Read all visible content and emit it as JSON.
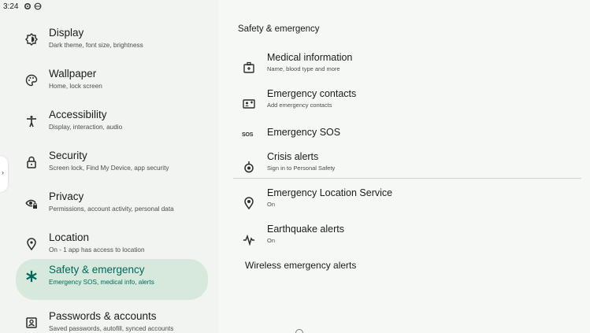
{
  "status_bar": {
    "time": "3:24",
    "icons": [
      "gear-icon",
      "vpn-icon",
      "wifi-icon"
    ]
  },
  "edge_handle": {
    "glyph": "›"
  },
  "sidebar": {
    "items": [
      {
        "title": "Display",
        "subtitle": "Dark theme, font size, brightness",
        "icon": "display-icon"
      },
      {
        "title": "Wallpaper",
        "subtitle": "Home, lock screen",
        "icon": "palette-icon"
      },
      {
        "title": "Accessibility",
        "subtitle": "Display, interaction, audio",
        "icon": "accessibility-icon"
      },
      {
        "title": "Security",
        "subtitle": "Screen lock, Find My Device, app security",
        "icon": "lock-icon"
      },
      {
        "title": "Privacy",
        "subtitle": "Permissions, account activity, personal data",
        "icon": "eye-lock-icon"
      },
      {
        "title": "Location",
        "subtitle": "On - 1 app has access to location",
        "icon": "location-pin-icon"
      },
      {
        "title": "Safety & emergency",
        "subtitle": "Emergency SOS, medical info, alerts",
        "icon": "asterisk-icon",
        "selected": true
      },
      {
        "title": "Passwords & accounts",
        "subtitle": "Saved passwords, autofill, synced accounts",
        "icon": "account-box-icon"
      }
    ]
  },
  "detail": {
    "title": "Safety & emergency",
    "items": [
      {
        "title": "Medical information",
        "subtitle": "Name, blood type and more",
        "icon": "medical-id-icon"
      },
      {
        "title": "Emergency contacts",
        "subtitle": "Add emergency contacts",
        "icon": "contact-card-icon"
      },
      {
        "title": "Emergency SOS",
        "subtitle": "",
        "icon": "sos-icon",
        "icon_text": "SOS"
      },
      {
        "title": "Crisis alerts",
        "subtitle": "Sign in to Personal Safety",
        "icon": "crisis-alert-icon"
      },
      {
        "title": "Emergency Location Service",
        "subtitle": "On",
        "icon": "location-target-icon"
      },
      {
        "title": "Earthquake alerts",
        "subtitle": "On",
        "icon": "seismograph-icon"
      }
    ],
    "wireless_alerts": "Wireless emergency alerts"
  },
  "colors": {
    "left_bg": "#f1f4f1",
    "right_bg": "#f6f8f5",
    "selected_bg": "#d7e8dc",
    "selected_text": "#00695c"
  }
}
